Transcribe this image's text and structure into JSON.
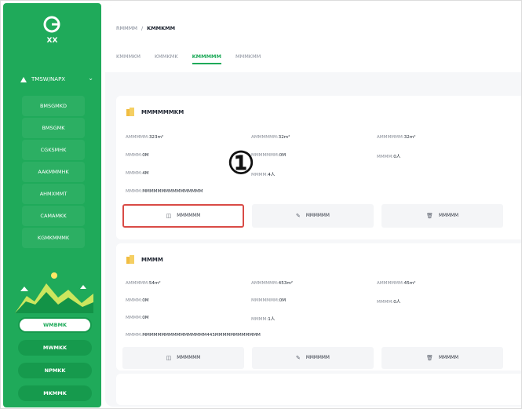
{
  "sidebar": {
    "logo_text": "XX",
    "group_label": "TMSW/NAPX",
    "items": [
      "BMSGMKD",
      "BMSGMK",
      "CGKSMHK",
      "AAKMMMHK",
      "AHMXMMT",
      "CAMAMKK",
      "KGMKMMMK"
    ],
    "pills": [
      {
        "label": "WMBMK"
      },
      {
        "label": "MWMKK"
      },
      {
        "label": "NPMKK"
      },
      {
        "label": "MKMMK"
      }
    ]
  },
  "breadcrumb": {
    "parent": "RMMMM",
    "separator": "/",
    "current": "KMMKMM"
  },
  "tabs": [
    {
      "label": "KMMMKM"
    },
    {
      "label": "KMMKMK"
    },
    {
      "label": "KMMMMM"
    },
    {
      "label": "MMMKMM"
    }
  ],
  "cards": [
    {
      "title": "MMMMMMKM",
      "fields": [
        {
          "label": "AMMMMM:",
          "value": "323m²"
        },
        {
          "label": "AMMMMMM:",
          "value": "32m²"
        },
        {
          "label": "AMMMMMM:",
          "value": "32m²"
        },
        {
          "label": "MMMM:",
          "value": "0M"
        },
        {
          "label": "MMMMMMM:",
          "value": "0M"
        },
        {
          "label": "MMMM:",
          "value": "0人"
        },
        {
          "label": "MMMM:",
          "value": "4M"
        },
        {
          "label": "MMMM:",
          "value": "4人"
        },
        {
          "label": "MMMM:",
          "value": "MMMMMMMMMMMMMMMM"
        }
      ],
      "actions": [
        {
          "label": "MMMMMM"
        },
        {
          "label": "MMMMMM"
        },
        {
          "label": "MMMMM"
        }
      ]
    },
    {
      "title": "MMMM",
      "fields": [
        {
          "label": "AMMMMM:",
          "value": "54m²"
        },
        {
          "label": "AMMMMMM:",
          "value": "453m²"
        },
        {
          "label": "AMMMMMM:",
          "value": "45m²"
        },
        {
          "label": "MMMM:",
          "value": "0M"
        },
        {
          "label": "MMMMMMM:",
          "value": "0M"
        },
        {
          "label": "MMMM:",
          "value": "0人"
        },
        {
          "label": "MMMM:",
          "value": "0M"
        },
        {
          "label": "MMMM:",
          "value": "1人"
        },
        {
          "label": "MMMM:",
          "value": "MMMMMMMMMMMMMMMMM445MMMMMMMMMMMM"
        }
      ],
      "actions": [
        {
          "label": "MMMMMM"
        },
        {
          "label": "MMMMMM"
        },
        {
          "label": "MMMMM"
        }
      ]
    }
  ],
  "marker": "①",
  "colors": {
    "brand": "#1faa5a",
    "highlight": "#d94b46"
  }
}
